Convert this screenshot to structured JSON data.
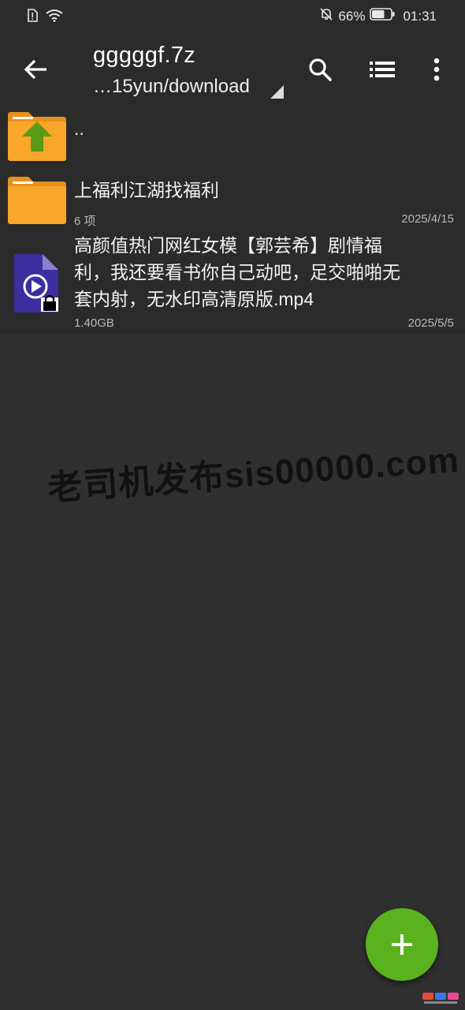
{
  "status": {
    "battery_percent": "66%",
    "time": "01:31",
    "battery_level": 0.66
  },
  "app_bar": {
    "title": "gggggf.7z",
    "path": "…15yun/download",
    "back_icon": "arrow-back-icon",
    "search_icon": "search-icon",
    "list_view_icon": "list-view-icon",
    "more_icon": "more-vert-icon"
  },
  "files": [
    {
      "name": "..",
      "icon": "folder-up-icon"
    },
    {
      "name": "上福利江湖找福利",
      "meta": "6 项",
      "date": "2025/4/15",
      "icon": "folder-icon"
    },
    {
      "name_lines": [
        "高颜值热门网红女模【郭芸希】剧情福",
        "利，我还要看书你自己动吧，足交啪啪无",
        "套内射，无水印高清原版.mp4"
      ],
      "meta": "1.40GB",
      "date": "2025/5/5",
      "icon": "video-file-locked-icon"
    }
  ],
  "watermark": "老司机发布sis00000.com",
  "fab": {
    "icon": "plus-icon"
  },
  "colors": {
    "background": "#303030",
    "bar": "#2b2b2b",
    "fab": "#5ab21e",
    "folder": "#f9a72b",
    "video": "#3d2f9e"
  }
}
